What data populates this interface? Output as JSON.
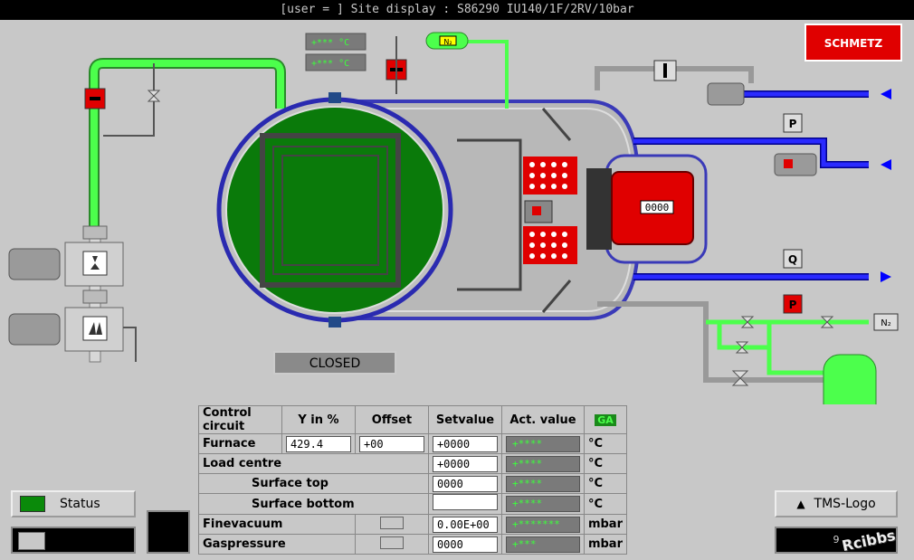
{
  "title": "[user = ] Site display : S86290 IU140/1F/2RV/10bar",
  "brand": "SCHMETZ",
  "readouts": {
    "top1": "+***  °C",
    "top2": "+***  °C",
    "n2_tag": "N₂",
    "n2_right": "N₂",
    "heater_value": "0000",
    "door_status": "CLOSED",
    "p1": "P",
    "p2": "P",
    "q": "Q"
  },
  "table": {
    "headers": [
      "Control circuit",
      "Y in %",
      "Offset",
      "Setvalue",
      "Act. value",
      "GA"
    ],
    "rows": [
      {
        "name": "Furnace",
        "y": "429.4",
        "offset": "+00",
        "set": "+0000",
        "act": "+****",
        "unit": "°C"
      },
      {
        "name": "Load centre",
        "set": "+0000",
        "act": "+****",
        "unit": "°C"
      },
      {
        "name": "Surface top",
        "set": "0000",
        "act": "+****",
        "unit": "°C"
      },
      {
        "name": "Surface bottom",
        "set": "",
        "act": "+****",
        "unit": "°C"
      },
      {
        "name": "Finevacuum",
        "set": "0.00E+00",
        "act": "+*******",
        "unit": "mbar"
      },
      {
        "name": "Gaspressure",
        "set": "0000",
        "act": "+***",
        "unit": "mbar"
      }
    ]
  },
  "status_label": "Status",
  "tms_label": "TMS-Logo",
  "tms_value": "9",
  "watermark": "Rcibbs",
  "colors": {
    "green_pipe": "#4cff4c",
    "blue_pipe": "#0000ff",
    "vessel_green": "#0a7a0a",
    "red": "#e00000"
  }
}
